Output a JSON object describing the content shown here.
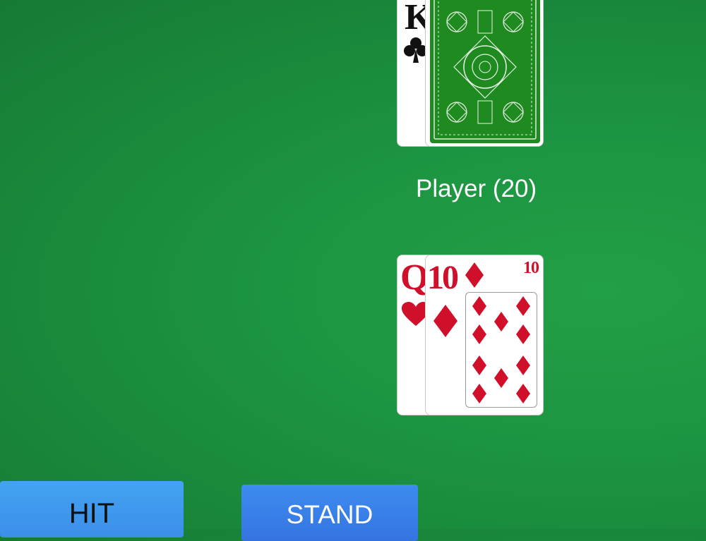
{
  "dealer": {
    "cards": [
      {
        "rank": "K",
        "suit": "clubs",
        "face_up": true
      },
      {
        "face_up": false,
        "back_color": "#1f8a1f"
      }
    ]
  },
  "player": {
    "label": "Player (20)",
    "cards": [
      {
        "rank": "Q",
        "suit": "hearts",
        "face_up": true
      },
      {
        "rank": "10",
        "suit": "diamonds",
        "face_up": true,
        "corner_label": "10"
      }
    ]
  },
  "controls": {
    "hit_label": "HIT",
    "stand_label": "STAND"
  },
  "colors": {
    "felt": "#1c9240",
    "card_red": "#d0102a",
    "card_black": "#111111",
    "hit_button": "#44a3f4",
    "stand_button": "#3d8cf0"
  }
}
